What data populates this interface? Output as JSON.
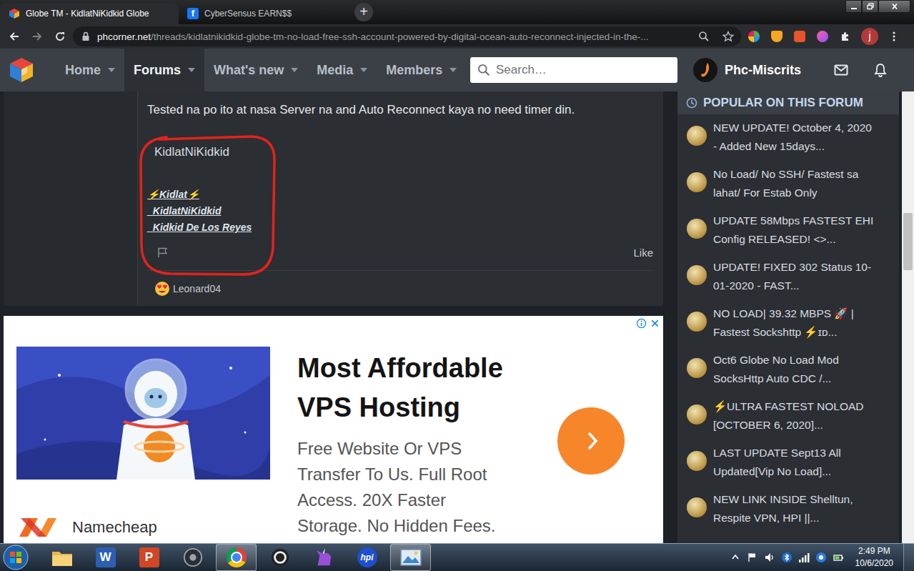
{
  "browser": {
    "tabs": [
      {
        "title": "Globe TM - KidlatNiKidkid Globe",
        "kind": "phcorner",
        "selected": true
      },
      {
        "title": "CyberSensus EARN$$",
        "kind": "facebook",
        "badge": "f",
        "selected": false
      }
    ],
    "new_tab": "+",
    "address": {
      "host": "phcorner.net",
      "path": "/threads/kidlatnikidkid-globe-tm-no-load-free-ssh-account-powered-by-digital-ocean-auto-reconnect-injected-in-the-..."
    },
    "profile_initial": "j"
  },
  "site": {
    "nav": [
      {
        "label": "Home",
        "selected": false
      },
      {
        "label": "Forums",
        "selected": true
      },
      {
        "label": "What's new",
        "selected": false
      },
      {
        "label": "Media",
        "selected": false
      },
      {
        "label": "Members",
        "selected": false
      }
    ],
    "search_placeholder": "Search…",
    "user": "Phc-Miscrits"
  },
  "post": {
    "message": "Tested na po ito at nasa Server na and Auto Reconnect kaya no need timer din.",
    "author": "KidlatNiKidkid",
    "signature": [
      "⚡Kidlat⚡",
      "_KidlatNiKidkid",
      "_Kidkid De Los Reyes"
    ],
    "like": "Like",
    "reactions": [
      {
        "user": "Leonard04"
      }
    ]
  },
  "ad": {
    "headline": [
      "Most Affordable",
      "VPS Hosting"
    ],
    "body": [
      "Free Website Or VPS",
      "Transfer To Us. Full Root",
      "Access. 20X Faster",
      "Storage. No Hidden Fees."
    ],
    "brand": "Namecheap"
  },
  "sidebar": {
    "title": "POPULAR ON THIS FORUM",
    "items": [
      {
        "lines": [
          "NEW UPDATE! October 4, 2020",
          "- Added New 15days..."
        ]
      },
      {
        "lines": [
          "No Load/ No SSH/ Fastest sa",
          "lahat/ For Estab Only"
        ]
      },
      {
        "lines": [
          "UPDATE 58Mbps FASTEST EHI",
          "Config RELEASED! <>..."
        ]
      },
      {
        "lines": [
          "UPDATE! FIXED 302 Status 10-",
          "01-2020 - FAST..."
        ]
      },
      {
        "lines": [
          "NO LOAD| 39.32 MBPS 🚀 |",
          "Fastest Sockshttp ⚡ɪᴅ..."
        ]
      },
      {
        "lines": [
          "Oct6 Globe No Load Mod",
          "SocksHttp Auto CDC /..."
        ]
      },
      {
        "lines": [
          "⚡ULTRA FASTEST NOLOAD",
          "[OCTOBER 6, 2020]..."
        ]
      },
      {
        "lines": [
          "LAST UPDATE Sept13 All",
          "Updated[Vip No Load]..."
        ]
      },
      {
        "lines": [
          "NEW LINK INSIDE Shelltun,",
          "Respite VPN, HPI ||..."
        ]
      }
    ]
  },
  "taskbar": {
    "apps": [
      {
        "kind": "explorer",
        "active": false
      },
      {
        "kind": "word",
        "label": "W",
        "active": false
      },
      {
        "kind": "powerpoint",
        "label": "P",
        "active": false
      },
      {
        "kind": "nox",
        "active": false
      },
      {
        "kind": "chrome",
        "active": true
      },
      {
        "kind": "ring",
        "active": false
      },
      {
        "kind": "unicorn",
        "active": false
      },
      {
        "kind": "hpi",
        "label": "hpi",
        "active": false
      },
      {
        "kind": "photos",
        "active": true
      }
    ],
    "time": "2:49 PM",
    "date": "10/6/2020"
  }
}
